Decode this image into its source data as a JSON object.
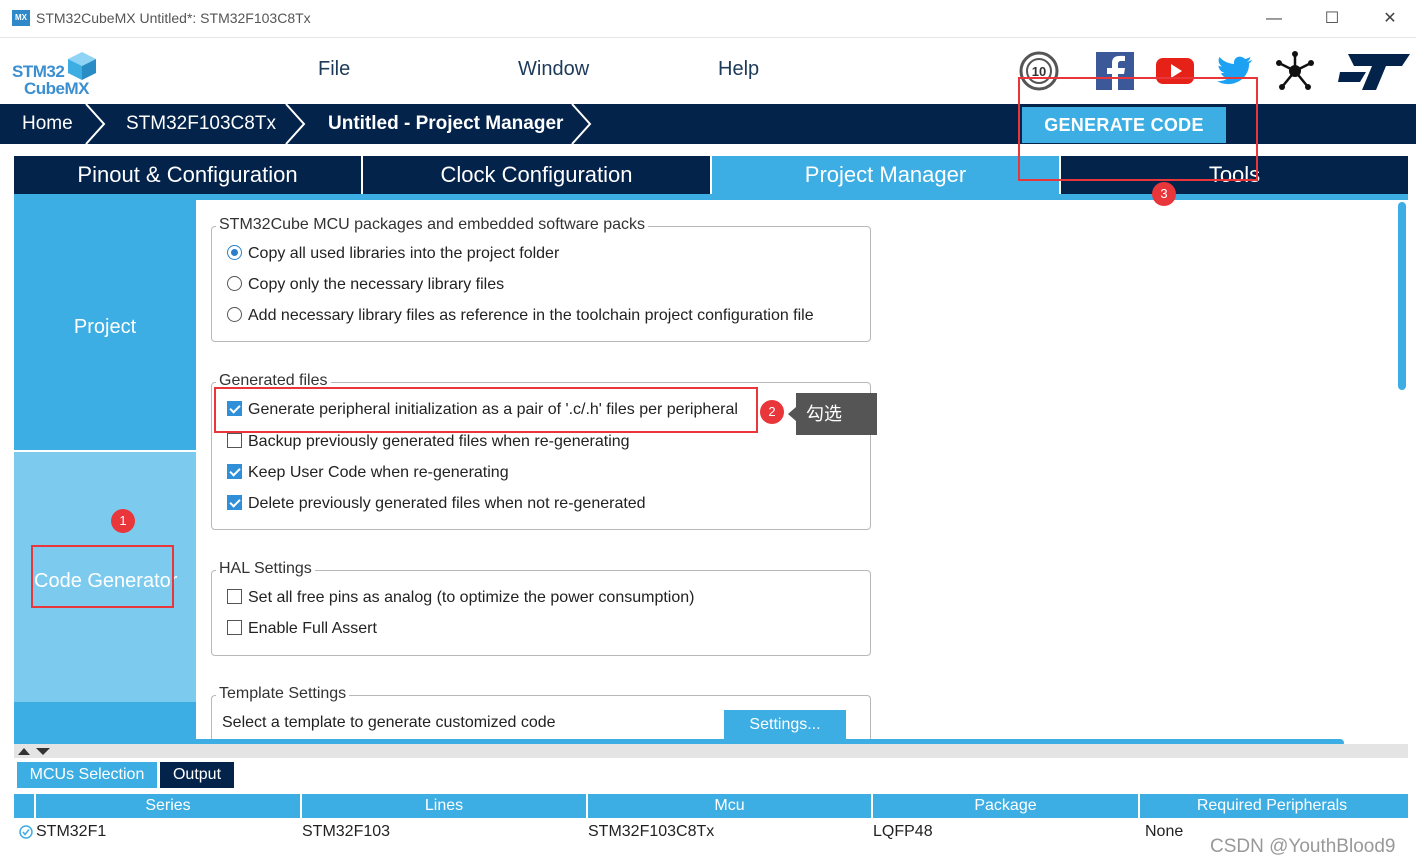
{
  "window": {
    "title": "STM32CubeMX Untitled*: STM32F103C8Tx",
    "app_icon_text": "MX",
    "minimize": "—",
    "maximize": "☐",
    "close": "✕"
  },
  "logo": {
    "line1": "STM32",
    "line2": "CubeMX"
  },
  "menu": {
    "file": "File",
    "window": "Window",
    "help": "Help"
  },
  "social_icons": [
    "anniversary-badge-icon",
    "facebook-icon",
    "youtube-icon",
    "twitter-icon",
    "network-icon",
    "st-logo-icon"
  ],
  "breadcrumb": {
    "home": "Home",
    "device": "STM32F103C8Tx",
    "current": "Untitled - Project Manager"
  },
  "generate_code": "GENERATE CODE",
  "tabs": {
    "pinout": "Pinout & Configuration",
    "clock": "Clock Configuration",
    "project_manager": "Project Manager",
    "tools": "Tools"
  },
  "sidenav": {
    "project": "Project",
    "code_generator": "Code Generator"
  },
  "packs": {
    "legend": "STM32Cube MCU packages and embedded software packs",
    "opt1": "Copy all used libraries into the project folder",
    "opt2": "Copy only the necessary library files",
    "opt3": "Add necessary library files as reference in the toolchain project configuration file",
    "selected": 1
  },
  "generated": {
    "legend": "Generated files",
    "opt1": "Generate peripheral initialization as a pair of '.c/.h' files per peripheral",
    "opt2": "Backup previously generated files when re-generating",
    "opt3": "Keep User Code when re-generating",
    "opt4": "Delete previously generated files when not re-generated",
    "checked": [
      true,
      false,
      true,
      true
    ]
  },
  "hal": {
    "legend": "HAL Settings",
    "opt1": "Set all free pins as analog (to optimize the power consumption)",
    "opt2": "Enable Full Assert",
    "checked": [
      false,
      false
    ]
  },
  "template": {
    "legend": "Template Settings",
    "text": "Select a template to generate customized code",
    "button": "Settings..."
  },
  "bottom_tabs": {
    "mcus": "MCUs Selection",
    "output": "Output"
  },
  "table": {
    "headers": [
      "Series",
      "Lines",
      "Mcu",
      "Package",
      "Required Peripherals"
    ],
    "row": [
      "STM32F1",
      "STM32F103",
      "STM32F103C8Tx",
      "LQFP48",
      "None"
    ]
  },
  "annotations": {
    "badge1": "1",
    "badge2": "2",
    "badge3": "3",
    "tooltip": "勾选"
  },
  "watermark": "CSDN @YouthBlood9",
  "colors": {
    "navy": "#03234b",
    "accent": "#3caee3",
    "accent_light": "#7ccbee",
    "annotation_red": "#e8363a"
  }
}
